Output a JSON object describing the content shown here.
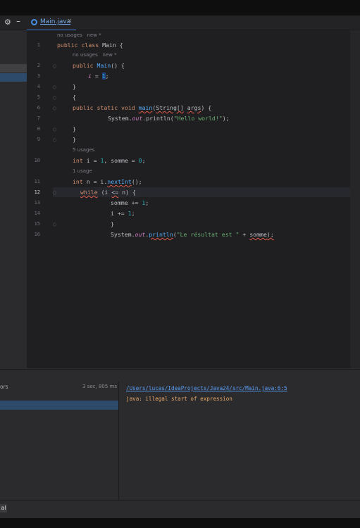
{
  "tab": {
    "file_name": "Main.java",
    "close": "×"
  },
  "toolbar": {
    "gear": "⚙",
    "minimize": "–"
  },
  "editor": {
    "hints": {
      "top": "no usages   new *",
      "ctor": "no usages   new *",
      "fields": "5 usages",
      "scanner": "1 usage"
    },
    "line_numbers": [
      "1",
      "2",
      "3",
      "4",
      "5",
      "6",
      "7",
      "8",
      "9",
      "10",
      "11",
      "12",
      "13",
      "14",
      "15",
      "16"
    ],
    "lines": {
      "l1": {
        "kw": "public class ",
        "name": "Main",
        "rest": " {"
      },
      "l2": {
        "kw": "public ",
        "name": "Main",
        "rest": "() {"
      },
      "l3": {
        "var": "i",
        "op": " = ",
        "sel": "1",
        "end": ";"
      },
      "l4": "}",
      "l5": "{",
      "l6": {
        "kw": "public static void ",
        "fn": "main",
        "p1": "(",
        "type": "String[]",
        "sp": " ",
        "arg": "args",
        "p2": ") {"
      },
      "l7": {
        "a": "System.",
        "fld": "out",
        "b": ".println(",
        "str": "\"Hello world!\"",
        "c": ");"
      },
      "l8": "}",
      "l9": "}",
      "l10": {
        "kw": "int ",
        "a": "i = ",
        "n1": "1",
        "b": ", somme = ",
        "n2": "0",
        "c": ";"
      },
      "l11": {
        "kw": "int ",
        "a": "n = i.",
        "call": "nextInt",
        "b": "();"
      },
      "l12": {
        "kw": "while",
        "a": " (i ",
        "op": "<=",
        "b": " n) {"
      },
      "l13": {
        "a": "somme += ",
        "n": "1",
        "b": ";"
      },
      "l14": {
        "a": "i += ",
        "n": "1",
        "b": ";"
      },
      "l15": "}",
      "l16": {
        "a": "System.",
        "fld": "out",
        "b": ".",
        "call": "println",
        "c": "(",
        "str": "\"Le résultat est \"",
        "d": " + ",
        "arg": "somme",
        "e": ");"
      }
    }
  },
  "build": {
    "tree_label": "ors",
    "duration": "3 sec, 805 ms",
    "error_path": "/Users/lucas/IdeaProjects/Java24/src/Main.java:6:5",
    "error_message": "java: illegal start of expression"
  },
  "status": {
    "left_tab": "al"
  }
}
